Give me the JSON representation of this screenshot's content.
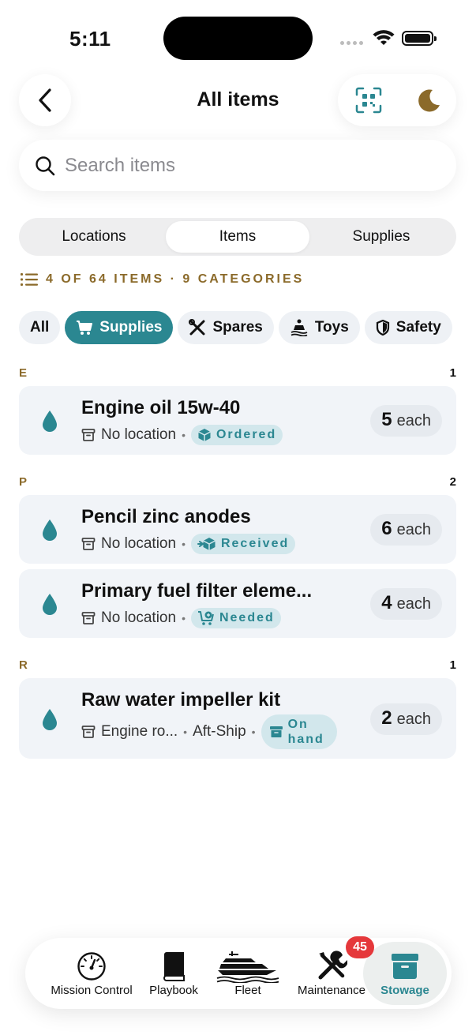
{
  "status": {
    "time": "5:11"
  },
  "header": {
    "title": "All items"
  },
  "search": {
    "placeholder": "Search items"
  },
  "segments": [
    {
      "label": "Locations"
    },
    {
      "label": "Items",
      "active": true
    },
    {
      "label": "Supplies"
    }
  ],
  "summary": {
    "text": "4 OF 64 ITEMS · 9 CATEGORIES"
  },
  "filters": [
    {
      "label": "All"
    },
    {
      "label": "Supplies",
      "active": true,
      "icon": "cart-icon"
    },
    {
      "label": "Spares",
      "icon": "tools-icon"
    },
    {
      "label": "Toys",
      "icon": "jetski-icon"
    },
    {
      "label": "Safety",
      "icon": "shield-icon"
    }
  ],
  "sections": [
    {
      "letter": "E",
      "count": "1"
    },
    {
      "letter": "P",
      "count": "2"
    },
    {
      "letter": "R",
      "count": "1"
    }
  ],
  "items": [
    {
      "name": "Engine oil 15w-40",
      "location": "No location",
      "status": "Ordered",
      "qty": "5",
      "unit": "each"
    },
    {
      "name": "Pencil zinc anodes",
      "location": "No location",
      "status": "Received",
      "qty": "6",
      "unit": "each"
    },
    {
      "name": "Primary fuel filter eleme...",
      "location": "No location",
      "status": "Needed",
      "qty": "4",
      "unit": "each"
    },
    {
      "name": "Raw water impeller kit",
      "location": "Engine ro...",
      "sublocation": "Aft-Ship",
      "status": "On hand",
      "qty": "2",
      "unit": "each"
    }
  ],
  "tabs": [
    {
      "label": "Mission Control",
      "icon": "gauge-icon"
    },
    {
      "label": "Playbook",
      "icon": "book-icon"
    },
    {
      "label": "Fleet",
      "icon": "yacht-icon"
    },
    {
      "label": "Maintenance",
      "icon": "wrench-screwdriver-icon",
      "badge": "45"
    },
    {
      "label": "Stowage",
      "icon": "box-icon",
      "active": true
    }
  ],
  "colors": {
    "accent": "#2b8791",
    "gold": "#8b6a2a",
    "badge": "#e5383b",
    "card": "#f1f4f8"
  }
}
